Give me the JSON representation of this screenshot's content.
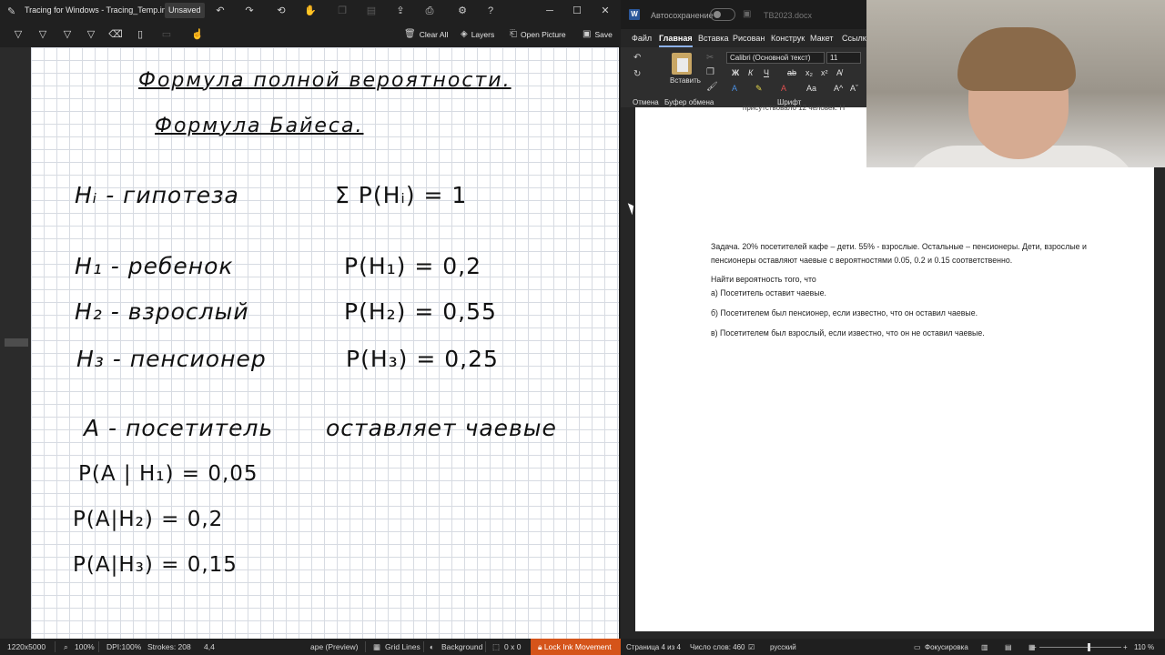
{
  "tracing": {
    "title": "Tracing for Windows - Tracing_Temp.ink",
    "unsaved": "Unsaved",
    "toolbar": {
      "clear_all": "Clear All",
      "layers": "Layers",
      "open_picture": "Open Picture",
      "save": "Save"
    },
    "canvas": {
      "line1": "Формула полной вероятности.",
      "line2": "Формула Байеса.",
      "h_i": "Hᵢ - гипотеза",
      "sum": "Σ P(Hᵢ) = 1",
      "h1": "H₁ - ребенок",
      "p1": "P(H₁) = 0,2",
      "h2": "H₂ - взрослый",
      "p2": "P(H₂) = 0,55",
      "h3": "H₃ - пенсионер",
      "p3": "P(H₃) = 0,25",
      "a_def1": "A - посетитель",
      "a_def2": "оставляет чаевые",
      "pa1": "P(A | H₁) = 0,05",
      "pa2": "P(A|H₂) = 0,2",
      "pa3": "P(A|H₃) = 0,15"
    },
    "status": {
      "size": "1220x5000",
      "zoom": "100%",
      "dpi": "DPI:100%",
      "strokes": "Strokes: 208",
      "coords": "4,4",
      "preview": "аре (Preview)",
      "grid": "Grid Lines",
      "background": "Background",
      "sel": "0 x 0",
      "lock": "Lock Ink Movement"
    }
  },
  "word": {
    "autosave": "Автосохранение",
    "doc_name": "TB2023.docx",
    "tabs": [
      "Файл",
      "Главная",
      "Вставка",
      "Рисован",
      "Конструк",
      "Макет",
      "Ссылки"
    ],
    "ribbon": {
      "paste": "Вставить",
      "font": "Calibri (Основной текст)",
      "size": "11",
      "undo_label": "Отмена",
      "clipboard_label": "Буфер обмена",
      "font_label": "Шрифт"
    },
    "doc": {
      "cut_text": "присутствовало 12 человек. Н",
      "task": "Задача. 20% посетителей кафе – дети. 55% - взрослые. Остальные – пенсионеры. Дети, взрослые и пенсионеры оставляют чаевые с вероятностями 0.05, 0.2 и 0.15 соответственно.",
      "find": "Найти вероятность того, что",
      "qa": "а) Посетитель оставит чаевые.",
      "qb": "б) Посетителем был пенсионер, если известно, что он оставил чаевые.",
      "qc": "в) Посетителем был взрослый, если известно, что он не оставил чаевые."
    },
    "status": {
      "page": "Страница 4 из 4",
      "words": "Число слов: 460",
      "lang": "русский",
      "focus": "Фокусировка",
      "zoom": "110 %"
    }
  },
  "colors": {
    "lock_bg": "#d5541a",
    "word_blue": "#2b579a",
    "grid": "#d7dbe2"
  }
}
